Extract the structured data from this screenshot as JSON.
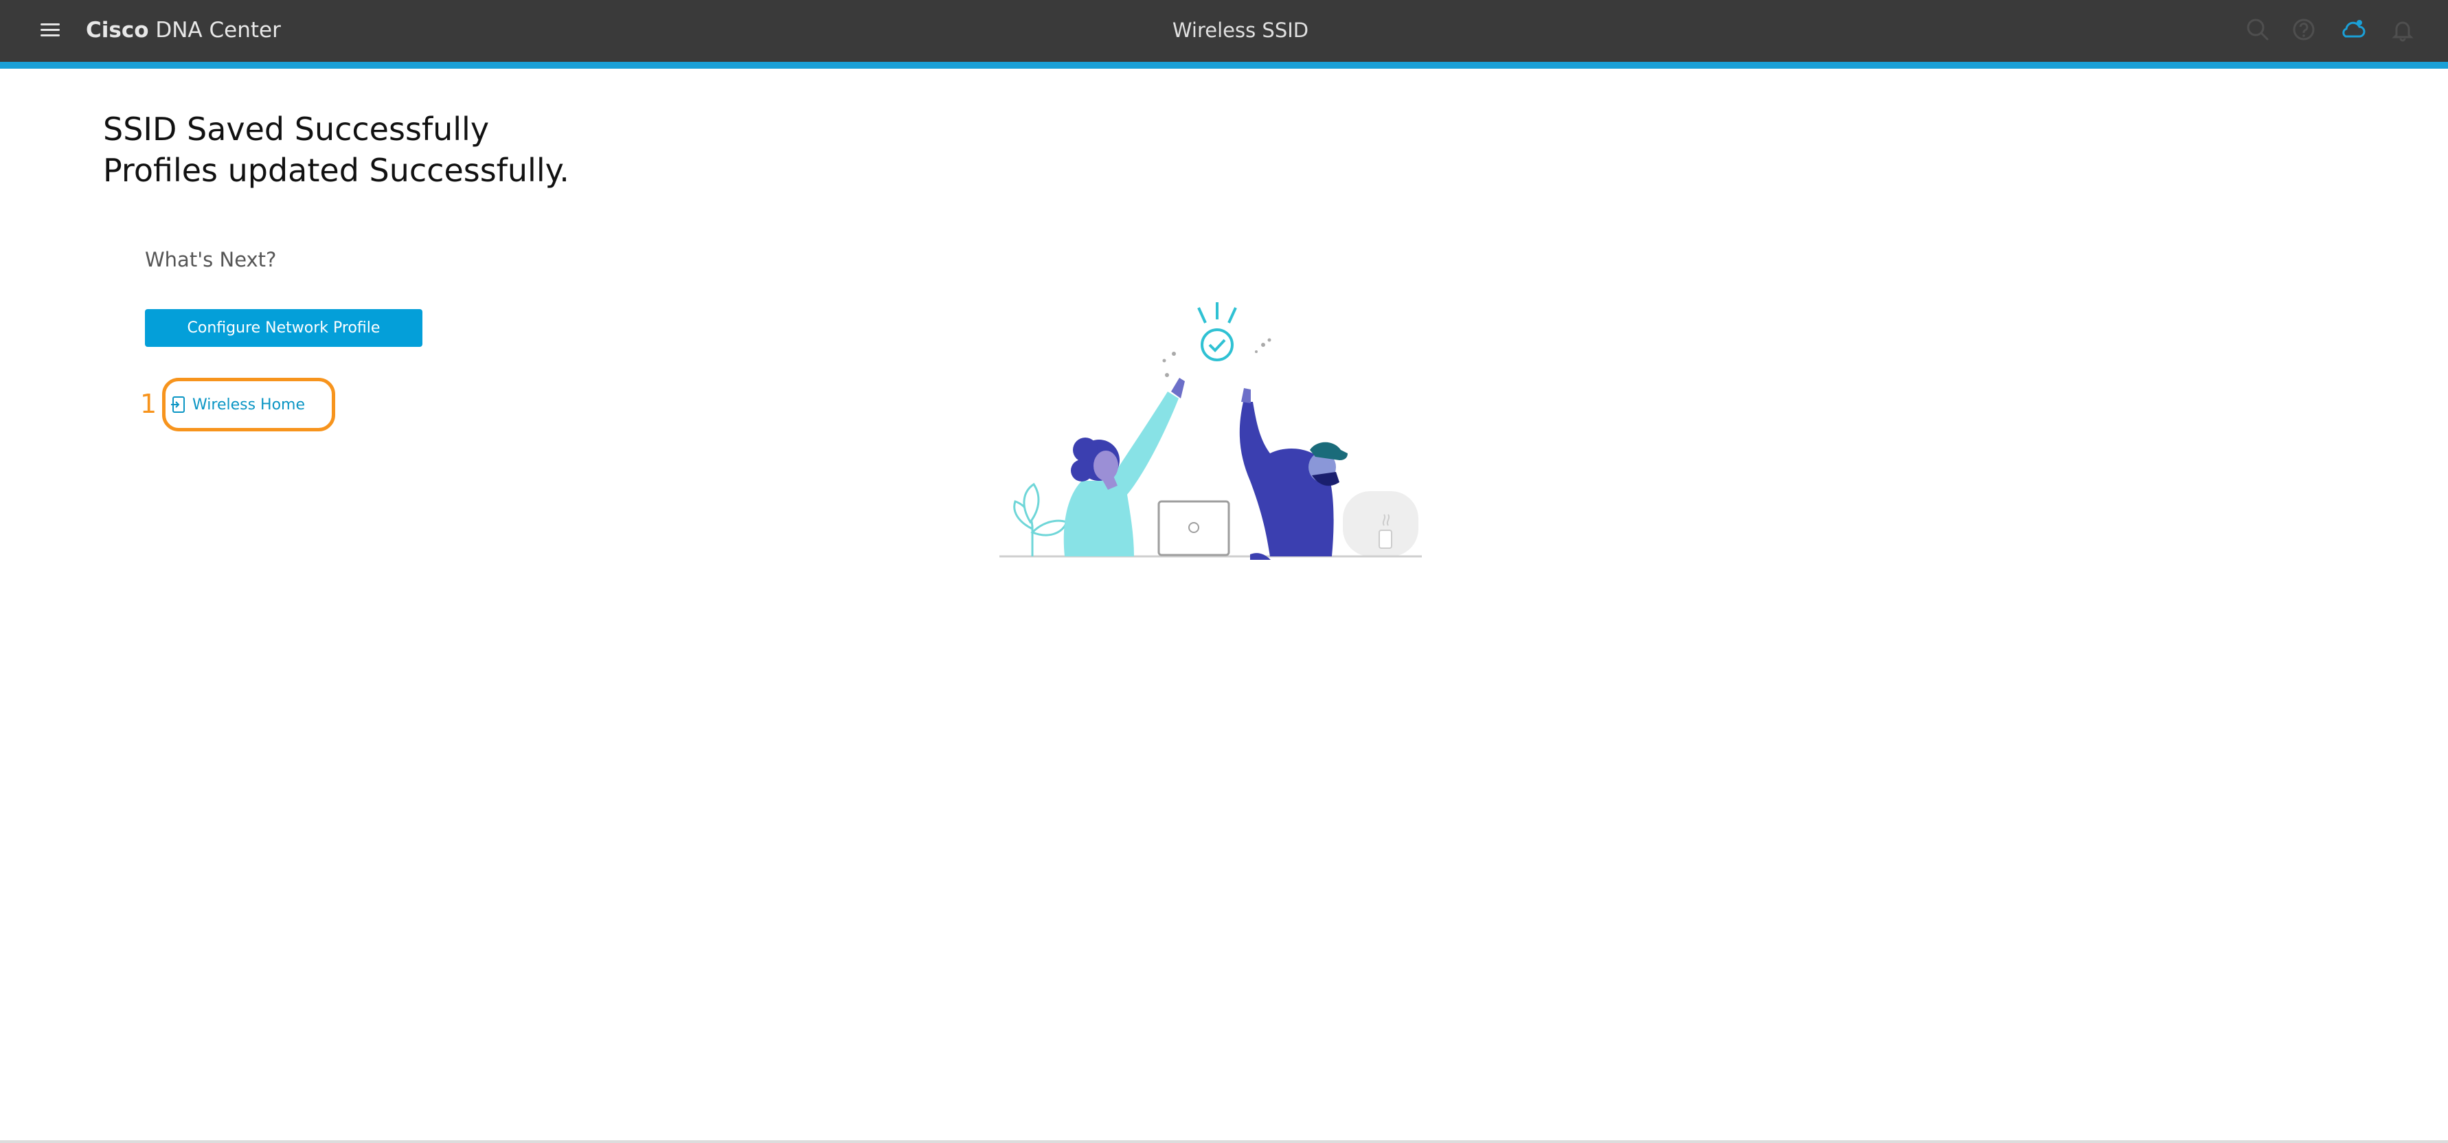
{
  "header": {
    "brand_bold": "Cisco",
    "brand_rest": "DNA Center",
    "title": "Wireless SSID",
    "icons": [
      "menu-icon",
      "search-icon",
      "help-icon",
      "cloud-notification-icon",
      "bell-icon"
    ]
  },
  "main": {
    "heading_line1": "SSID Saved Successfully",
    "heading_line2": "Profiles updated Successfully.",
    "whats_next": "What's Next?",
    "configure_button": "Configure Network Profile",
    "step_number": "1",
    "wireless_home_link": "Wireless Home",
    "illustration": "high-five-success-illustration"
  },
  "colors": {
    "header_bg": "#3a3a3a",
    "accent": "#1ba0d7",
    "button": "#049fd9",
    "link": "#0a95c4",
    "callout": "#f7941d"
  }
}
